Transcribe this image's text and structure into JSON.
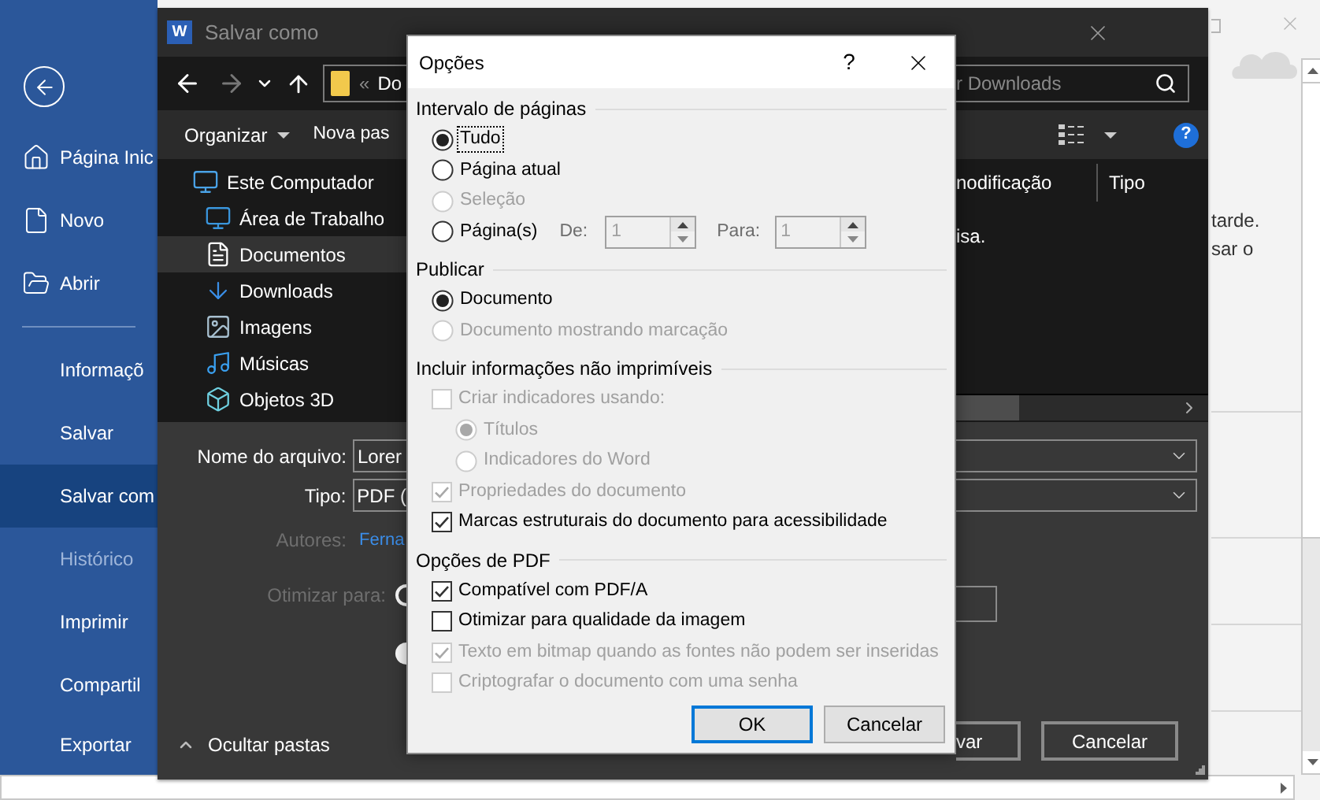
{
  "backstage": {
    "primary_items": [
      {
        "label": "Página Inic",
        "selected": false,
        "disabled": false
      },
      {
        "label": "Novo",
        "selected": false,
        "disabled": false
      },
      {
        "label": "Abrir",
        "selected": false,
        "disabled": false
      }
    ],
    "items": [
      {
        "label": "Informaçõ",
        "selected": false,
        "disabled": false
      },
      {
        "label": "Salvar",
        "selected": false,
        "disabled": false
      },
      {
        "label": "Salvar com",
        "selected": true,
        "disabled": false
      },
      {
        "label": "Histórico",
        "selected": false,
        "disabled": true
      },
      {
        "label": "Imprimir",
        "selected": false,
        "disabled": false
      },
      {
        "label": "Compartil",
        "selected": false,
        "disabled": false
      },
      {
        "label": "Exportar",
        "selected": false,
        "disabled": false
      }
    ],
    "page_text": [
      "tarde.",
      "sar o"
    ]
  },
  "save_dialog": {
    "app_icon_letter": "W",
    "title": "Salvar como",
    "address_chevrons": "«",
    "address": "Do",
    "search": {
      "placeholder": "r Downloads"
    },
    "organize": "Organizar",
    "new_folder": "Nova pas",
    "help": "?",
    "nav": [
      {
        "label": "Este Computador",
        "selected": false,
        "children": [
          {
            "label": "Área de Trabalho",
            "selected": false
          },
          {
            "label": "Documentos",
            "selected": true
          },
          {
            "label": "Downloads",
            "selected": false
          },
          {
            "label": "Imagens",
            "selected": false
          },
          {
            "label": "Músicas",
            "selected": false
          },
          {
            "label": "Objetos 3D",
            "selected": false
          }
        ]
      }
    ],
    "columns": [
      "nodificação",
      "Tipo"
    ],
    "empty_message": "isa.",
    "filename_label": "Nome do arquivo:",
    "filename": "Lorer",
    "type_label": "Tipo:",
    "type": "PDF (",
    "authors_label": "Autores:",
    "authors": "Ferna",
    "optimize_label": "Otimizar para:",
    "optimize_options": [
      {
        "selected": false
      },
      {
        "selected": true
      }
    ],
    "save_button": "var",
    "cancel_button": "Cancelar",
    "hide_folders": "Ocultar pastas"
  },
  "options_dialog": {
    "title": "Opções",
    "help": "?",
    "sections": [
      {
        "title": "Intervalo de páginas",
        "items": [
          {
            "kind": "radio",
            "label": "Tudo",
            "selected": true,
            "disabled": false,
            "focused": true
          },
          {
            "kind": "radio",
            "label": "Página atual",
            "selected": false,
            "disabled": false,
            "focused": false
          },
          {
            "kind": "radio",
            "label": "Seleção",
            "selected": false,
            "disabled": true,
            "focused": false
          },
          {
            "kind": "page_range",
            "label": "Página(s)",
            "selected": false,
            "disabled": false,
            "focused": false,
            "from_label": "De:",
            "from": "1",
            "to_label": "Para:",
            "to": "1",
            "fields_disabled": true
          }
        ]
      },
      {
        "title": "Publicar",
        "items": [
          {
            "kind": "radio",
            "label": "Documento",
            "selected": true,
            "disabled": false,
            "focused": false
          },
          {
            "kind": "radio",
            "label": "Documento mostrando marcação",
            "selected": false,
            "disabled": true,
            "focused": false
          }
        ]
      },
      {
        "title": "Incluir informações não imprimíveis",
        "items": [
          {
            "kind": "checkbox",
            "label": "Criar indicadores usando:",
            "checked": false,
            "disabled": true,
            "focused": false,
            "children": [
              {
                "kind": "radio",
                "label": "Títulos",
                "selected": true,
                "disabled": true,
                "focused": false
              },
              {
                "kind": "radio",
                "label": "Indicadores do Word",
                "selected": false,
                "disabled": true,
                "focused": false
              }
            ]
          },
          {
            "kind": "checkbox",
            "label": "Propriedades do documento",
            "checked": true,
            "disabled": true,
            "focused": false
          },
          {
            "kind": "checkbox",
            "label": "Marcas estruturais do documento para acessibilidade",
            "checked": true,
            "disabled": false,
            "focused": false
          }
        ]
      },
      {
        "title": "Opções de PDF",
        "items": [
          {
            "kind": "checkbox",
            "label": "Compatível com PDF/A",
            "checked": true,
            "disabled": false,
            "focused": false
          },
          {
            "kind": "checkbox",
            "label": "Otimizar para qualidade da imagem",
            "checked": false,
            "disabled": false,
            "focused": false
          },
          {
            "kind": "checkbox",
            "label": "Texto em bitmap quando as fontes não podem ser inseridas",
            "checked": true,
            "disabled": true,
            "focused": false
          },
          {
            "kind": "checkbox",
            "label": "Criptografar o documento com uma senha",
            "checked": false,
            "disabled": true,
            "focused": false
          }
        ]
      }
    ],
    "buttons": [
      {
        "label": "OK",
        "default": true
      },
      {
        "label": "Cancelar",
        "default": false
      }
    ]
  }
}
